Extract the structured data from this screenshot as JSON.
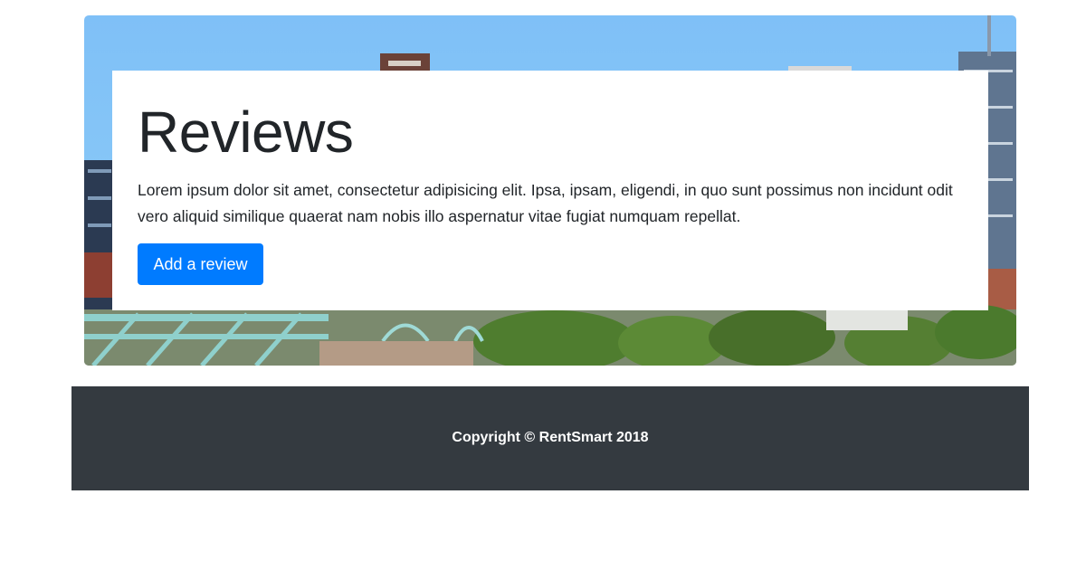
{
  "hero": {
    "title": "Reviews",
    "lead": "Lorem ipsum dolor sit amet, consectetur adipisicing elit. Ipsa, ipsam, eligendi, in quo sunt possimus non incidunt odit vero aliquid similique quaerat nam nobis illo aspernatur vitae fugiat numquam repellat.",
    "button_label": "Add a review"
  },
  "footer": {
    "copyright": "Copyright © RentSmart 2018"
  },
  "colors": {
    "primary": "#007bff",
    "footer_bg": "#343a40"
  }
}
